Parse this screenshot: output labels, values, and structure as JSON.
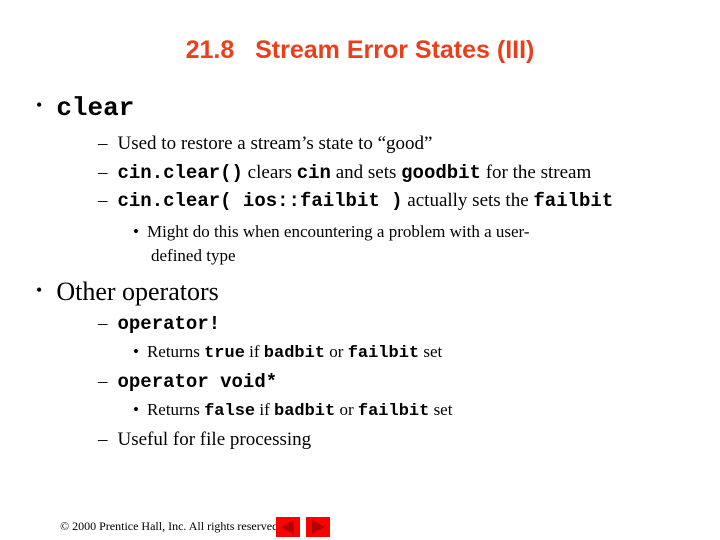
{
  "slide": {
    "title": "21.8   Stream Error States (III)",
    "bullets": [
      {
        "marker": "•",
        "text": "clear"
      },
      {
        "marker": "–",
        "text": "Used to restore a stream’s state to “good”"
      },
      {
        "marker": "–",
        "code1": "cin.clear()",
        "text1": " clears ",
        "code2": "cin",
        "text2": " and sets ",
        "code3": "goodbit",
        "text3": " for the stream"
      },
      {
        "marker": "–",
        "code1": "cin.clear( ios::failbit )",
        "text1": " actually sets the ",
        "code2": "failbit"
      },
      {
        "marker": "•",
        "text": "Might do this when encountering a problem with a user-",
        "text_cont": "defined type"
      },
      {
        "marker": "•",
        "text": "Other operators"
      },
      {
        "marker": "–",
        "code1": "operator!"
      },
      {
        "marker": "•",
        "text1": "Returns ",
        "code1": "true",
        "text2": " if ",
        "code2": "badbit",
        "text3": " or ",
        "code3": "failbit",
        "text4": " set"
      },
      {
        "marker": "–",
        "code1": "operator void*"
      },
      {
        "marker": "•",
        "text1": "Returns ",
        "code1": "false",
        "text2": " if ",
        "code2": "badbit",
        "text3": " or ",
        "code3": "failbit",
        "text4": " set"
      },
      {
        "marker": "–",
        "text": "Useful for file processing"
      }
    ]
  },
  "footer": {
    "copyright": "© 2000 Prentice Hall, Inc.  All rights reserved."
  },
  "nav": {
    "prev_icon": "triangle-left-icon",
    "next_icon": "triangle-right-icon",
    "color": "#ff0000",
    "arrow_color": "#b00000"
  }
}
